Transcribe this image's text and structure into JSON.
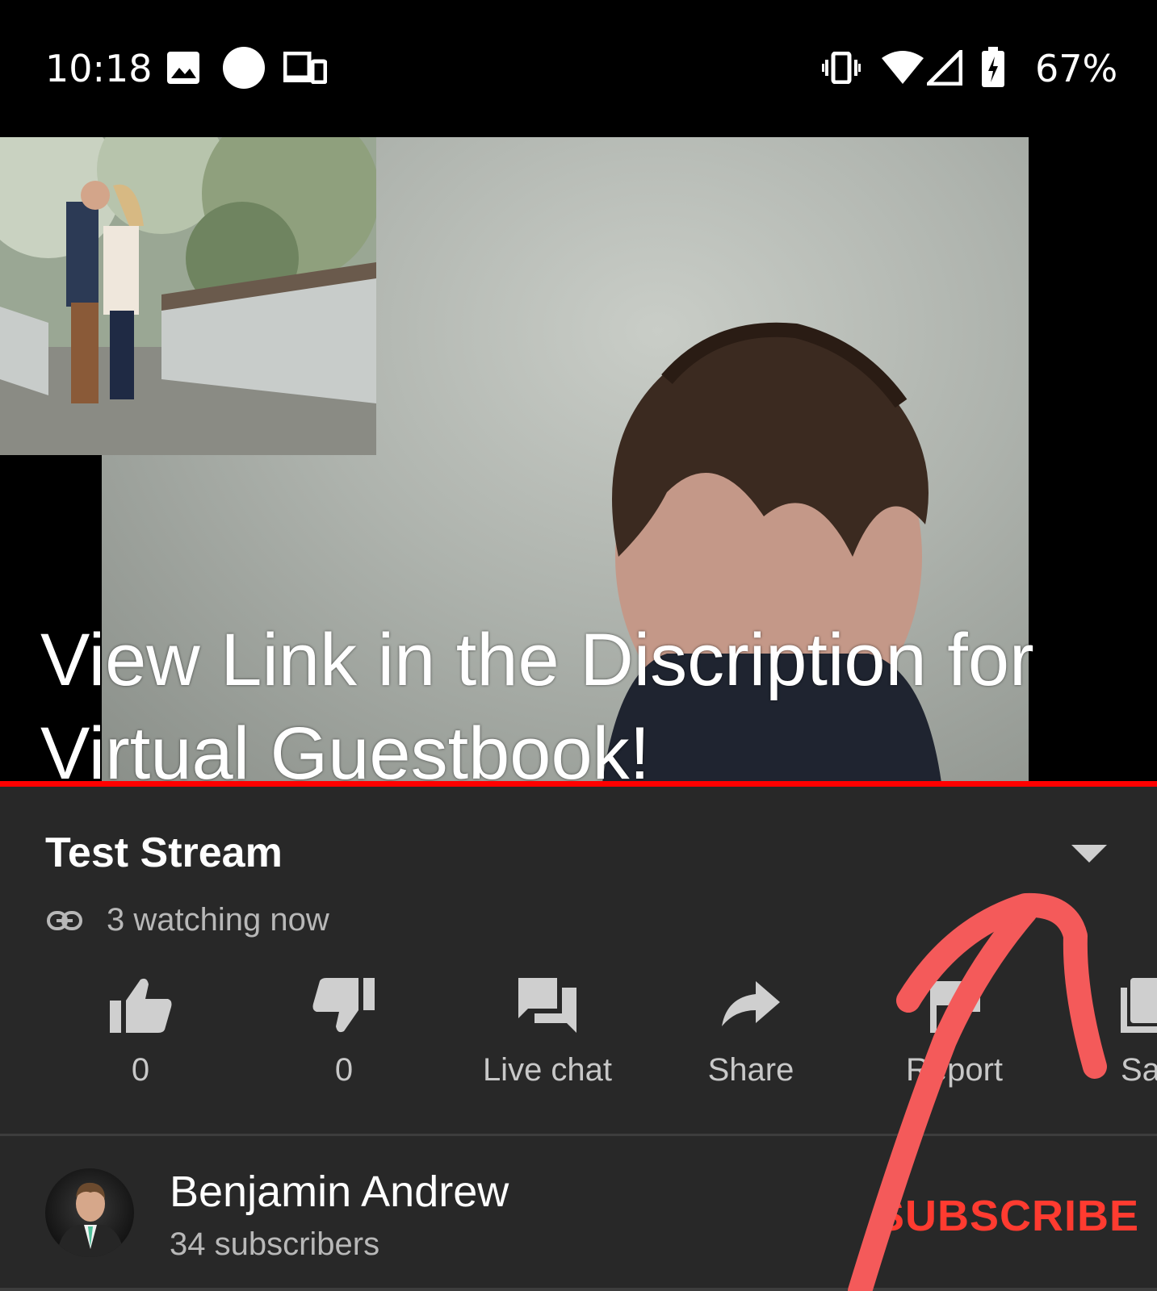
{
  "status_bar": {
    "time": "10:18",
    "icons": [
      "image-icon",
      "circle-icon",
      "devices-icon",
      "vibrate-icon",
      "wifi-icon",
      "signal-icon",
      "battery-charging-icon"
    ],
    "battery": "67%"
  },
  "player": {
    "caption_line1": "View Link in the Discription for",
    "caption_line2": "Virtual Guestbook!",
    "progress_color": "#ff0000"
  },
  "video": {
    "title": "Test Stream",
    "watching": "3 watching now"
  },
  "actions": [
    {
      "icon": "thumbs-up-icon",
      "label": "0"
    },
    {
      "icon": "thumbs-down-icon",
      "label": "0"
    },
    {
      "icon": "live-chat-icon",
      "label": "Live chat"
    },
    {
      "icon": "share-icon",
      "label": "Share"
    },
    {
      "icon": "flag-icon",
      "label": "Report"
    },
    {
      "icon": "save-icon",
      "label": "Save"
    }
  ],
  "channel": {
    "name": "Benjamin Andrew",
    "subscribers": "34 subscribers",
    "subscribe_label": "SUBSCRIBE"
  },
  "colors": {
    "background": "#282828",
    "accent": "#ff0000",
    "subscribe": "#ff3b30",
    "annotation_arrow": "#f45a5a"
  }
}
